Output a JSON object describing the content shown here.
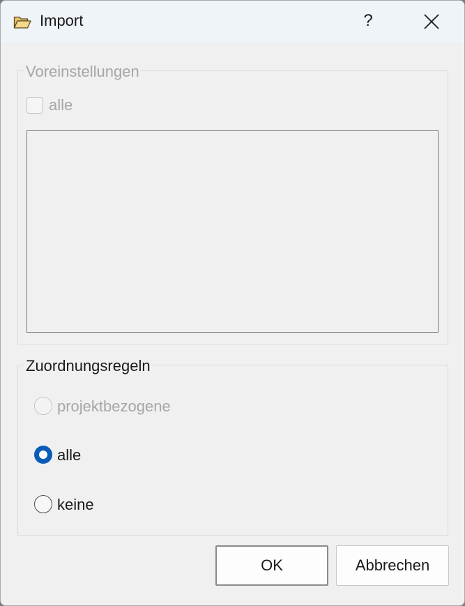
{
  "window": {
    "title": "Import",
    "help_label": "?",
    "icon": "folder-open-icon",
    "close_icon": "close-icon"
  },
  "presets": {
    "legend": "Voreinstellungen",
    "all_checkbox_label": "alle",
    "all_checked": false,
    "items": []
  },
  "rules": {
    "legend": "Zuordnungsregeln",
    "options": [
      {
        "label": "projektbezogene",
        "selected": false,
        "enabled": false
      },
      {
        "label": "alle",
        "selected": true,
        "enabled": true
      },
      {
        "label": "keine",
        "selected": false,
        "enabled": true
      }
    ]
  },
  "buttons": {
    "ok": "OK",
    "cancel": "Abbrechen"
  },
  "colors": {
    "accent": "#0a5cb8",
    "disabled_text": "#a6a6a6",
    "titlebar": "#eff4f9"
  }
}
